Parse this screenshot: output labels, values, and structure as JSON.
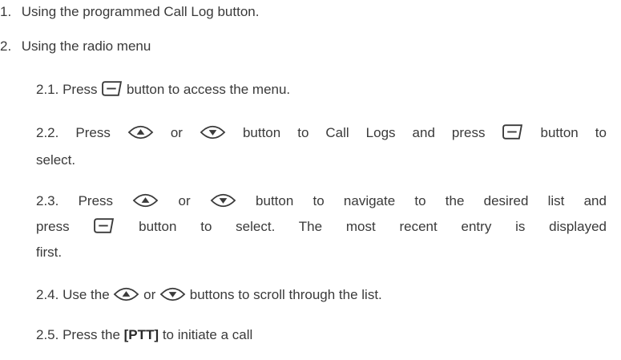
{
  "items": [
    {
      "num": "1.",
      "text": "Using the programmed Call Log button."
    },
    {
      "num": "2.",
      "text": "Using the radio menu"
    }
  ],
  "steps": {
    "s1": {
      "num": "2.1.",
      "pre": "Press",
      "post": "button to access the menu."
    },
    "s2": {
      "num": "2.2.",
      "pre": "Press",
      "or": "or",
      "mid": "button to Call Logs and press",
      "post": "button to",
      "cont": "select."
    },
    "s3": {
      "num": "2.3.",
      "pre": "Press",
      "or": "or",
      "mid": "button to navigate to the desired list and",
      "line2_pre": "press",
      "line2_post": "button to select. The most recent entry is displayed",
      "cont": "first."
    },
    "s4": {
      "num": "2.4.",
      "pre": "Use the",
      "or": "or",
      "post": "buttons to scroll through the list."
    },
    "s5": {
      "num": "2.5.",
      "pre": "Press the",
      "bold": "[PTT]",
      "post": "to initiate a call"
    }
  },
  "icons": {
    "menu": "menu-ok-key-icon",
    "up": "up-arrow-key-icon",
    "down": "down-arrow-key-icon"
  }
}
